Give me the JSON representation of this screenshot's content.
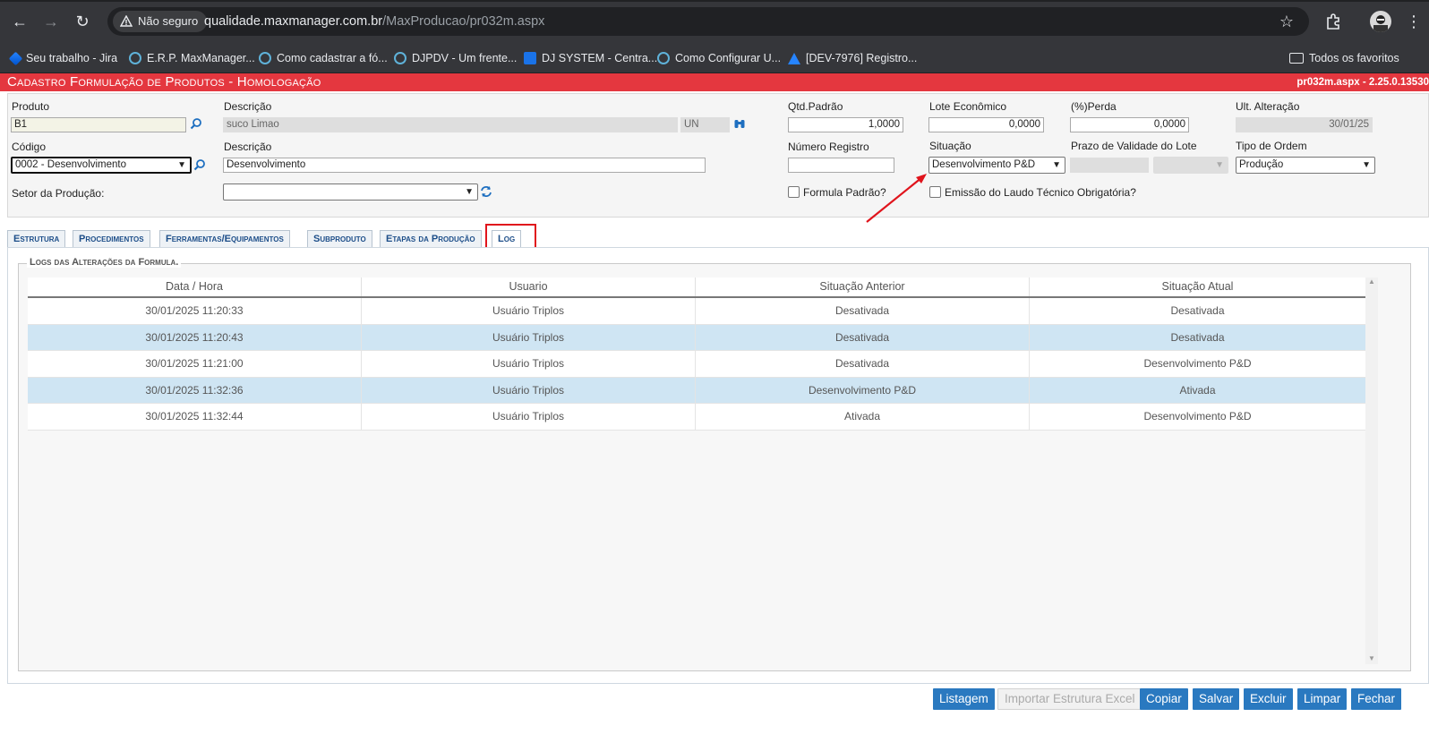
{
  "browser": {
    "security_label": "Não seguro",
    "url_host": "qualidade.maxmanager.com.br",
    "url_path": "/MaxProducao/pr032m.aspx",
    "bookmarks": [
      "Seu trabalho - Jira",
      "E.R.P. MaxManager...",
      "Como cadastrar a fó...",
      "DJPDV - Um frente...",
      "DJ SYSTEM - Centra...",
      "Como Configurar U...",
      "[DEV-7976] Registro..."
    ],
    "all_favorites": "Todos os favoritos"
  },
  "app": {
    "title": "Cadastro Formulação de Produtos  - Homologação",
    "page_version": "pr032m.aspx - 2.25.0.13530"
  },
  "form": {
    "produto": {
      "label": "Produto",
      "value": "B1"
    },
    "descricao_produto": {
      "label": "Descrição",
      "value": "suco Limao",
      "unit": "UN"
    },
    "qtd_padrao": {
      "label": "Qtd.Padrão",
      "value": "1,0000"
    },
    "lote_economico": {
      "label": "Lote Econômico",
      "value": "0,0000"
    },
    "perda": {
      "label": "(%)Perda",
      "value": "0,0000"
    },
    "ult_alteracao": {
      "label": "Ult. Alteração",
      "value": "30/01/25"
    },
    "codigo": {
      "label": "Código",
      "value": "0002 - Desenvolvimento"
    },
    "descricao": {
      "label": "Descrição",
      "value": "Desenvolvimento"
    },
    "numero_registro": {
      "label": "Número Registro",
      "value": ""
    },
    "situacao": {
      "label": "Situação",
      "value": "Desenvolvimento P&D"
    },
    "prazo_validade": {
      "label": "Prazo de Validade do Lote",
      "value": ""
    },
    "tipo_ordem": {
      "label": "Tipo de Ordem",
      "value": "Produção"
    },
    "setor_producao": {
      "label": "Setor da Produção:",
      "value": ""
    },
    "formula_padrao": {
      "label": "Formula Padrão?",
      "checked": false
    },
    "laudo_tecnico": {
      "label": "Emissão do Laudo Técnico Obrigatória?",
      "checked": false
    }
  },
  "tabs": [
    "Estrutura",
    "Procedimentos",
    "Ferramentas/Equipamentos",
    "Subproduto",
    "Etapas da Produção",
    "Log"
  ],
  "active_tab": "Log",
  "log": {
    "legend": "Logs das Alterações da Formula.",
    "columns": [
      "Data / Hora",
      "Usuario",
      "Situação Anterior",
      "Situação Atual"
    ],
    "rows": [
      [
        "30/01/2025 11:20:33",
        "Usuário Triplos",
        "Desativada",
        "Desativada"
      ],
      [
        "30/01/2025 11:20:43",
        "Usuário Triplos",
        "Desativada",
        "Desativada"
      ],
      [
        "30/01/2025 11:21:00",
        "Usuário Triplos",
        "Desativada",
        "Desenvolvimento P&D"
      ],
      [
        "30/01/2025 11:32:36",
        "Usuário Triplos",
        "Desenvolvimento P&D",
        "Ativada"
      ],
      [
        "30/01/2025 11:32:44",
        "Usuário Triplos",
        "Ativada",
        "Desenvolvimento P&D"
      ]
    ]
  },
  "buttons": {
    "listagem": "Listagem",
    "importar": "Importar Estrutura Excel",
    "copiar": "Copiar",
    "salvar": "Salvar",
    "excluir": "Excluir",
    "limpar": "Limpar",
    "fechar": "Fechar"
  },
  "colors": {
    "title_bar": "#e4373f",
    "button": "#2a79c0",
    "row_alt": "#cfe5f3",
    "annotation": "#e0141c"
  }
}
